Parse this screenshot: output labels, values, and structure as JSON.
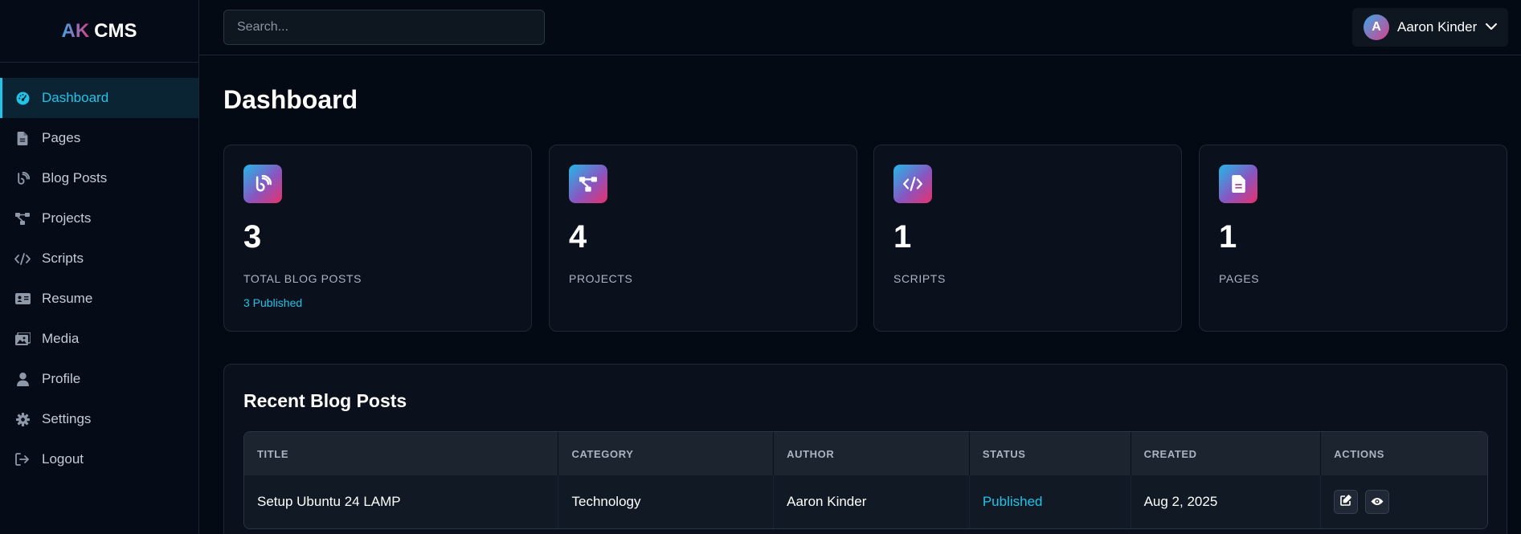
{
  "app": {
    "logo_ak": "AK",
    "logo_cms": "CMS"
  },
  "sidebar": {
    "items": [
      {
        "label": "Dashboard",
        "icon": "dashboard-icon",
        "active": true
      },
      {
        "label": "Pages",
        "icon": "file-icon"
      },
      {
        "label": "Blog Posts",
        "icon": "blog-icon"
      },
      {
        "label": "Projects",
        "icon": "project-diagram-icon"
      },
      {
        "label": "Scripts",
        "icon": "code-icon"
      },
      {
        "label": "Resume",
        "icon": "id-card-icon"
      },
      {
        "label": "Media",
        "icon": "images-icon"
      },
      {
        "label": "Profile",
        "icon": "user-icon"
      },
      {
        "label": "Settings",
        "icon": "gear-icon"
      },
      {
        "label": "Logout",
        "icon": "logout-icon"
      }
    ]
  },
  "topbar": {
    "search_placeholder": "Search...",
    "user_initial": "A",
    "user_name": "Aaron Kinder"
  },
  "page": {
    "title": "Dashboard"
  },
  "stats": [
    {
      "value": "3",
      "label": "TOTAL BLOG POSTS",
      "sub": "3 Published",
      "icon": "blog-icon"
    },
    {
      "value": "4",
      "label": "PROJECTS",
      "icon": "project-diagram-icon"
    },
    {
      "value": "1",
      "label": "SCRIPTS",
      "icon": "code-icon"
    },
    {
      "value": "1",
      "label": "PAGES",
      "icon": "file-icon"
    }
  ],
  "recent": {
    "title": "Recent Blog Posts",
    "columns": [
      "TITLE",
      "CATEGORY",
      "AUTHOR",
      "STATUS",
      "CREATED",
      "ACTIONS"
    ],
    "rows": [
      {
        "title": "Setup Ubuntu 24 LAMP",
        "category": "Technology",
        "author": "Aaron Kinder",
        "status": "Published",
        "created": "Aug 2, 2025"
      }
    ]
  },
  "colors": {
    "accent": "#22c3e8",
    "background": "#040a14",
    "gradient_start": "#22b8e8",
    "gradient_end": "#e8306a"
  }
}
